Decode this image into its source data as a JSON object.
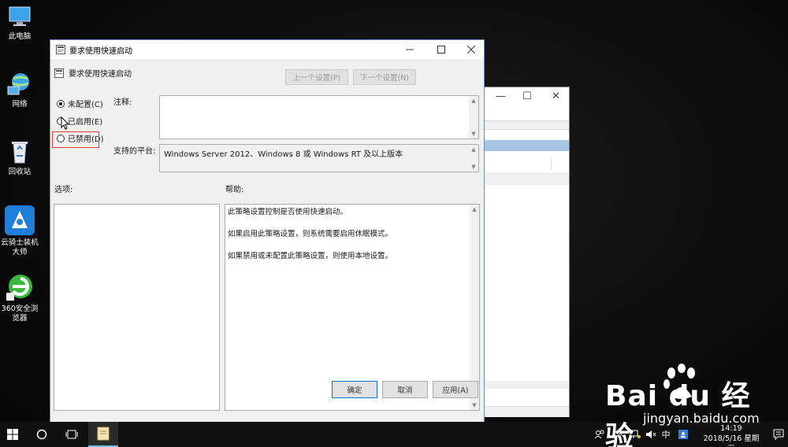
{
  "desktop": {
    "icons": [
      {
        "label": "此电脑",
        "icon": "this-pc-icon"
      },
      {
        "label": "网络",
        "icon": "network-icon"
      },
      {
        "label": "回收站",
        "icon": "recycle-bin-icon"
      },
      {
        "label": "云骑士装机大师",
        "icon": "yunqishi-icon"
      },
      {
        "label": "360安全浏览器",
        "icon": "browser-360-icon"
      }
    ]
  },
  "background_window": {
    "minimize": "—",
    "maximize": "☐",
    "close": "✕"
  },
  "dialog": {
    "title": "要求使用快速启动",
    "setting_name": "要求使用快速启动",
    "prev_button": "上一个设置(P)",
    "next_button": "下一个设置(N)",
    "radios": [
      {
        "label": "未配置(C)",
        "checked": true
      },
      {
        "label": "已启用(E)",
        "checked": false
      },
      {
        "label": "已禁用(D)",
        "checked": false
      }
    ],
    "comment_label": "注释:",
    "comment_value": "",
    "platform_label": "支持的平台:",
    "platform_value": "Windows Server 2012、Windows 8 或 Windows RT 及以上版本",
    "options_label": "选项:",
    "help_label": "帮助:",
    "help_paragraphs": [
      "此策略设置控制是否使用快速启动。",
      "如果启用此策略设置，则系统需要启用休眠模式。",
      "如果禁用或未配置此策略设置，则使用本地设置。"
    ],
    "ok_button": "确定",
    "cancel_button": "取消",
    "apply_button": "应用(A)"
  },
  "taskbar": {
    "ime": "中",
    "time": "14:19",
    "date": "2018/5/16 星期三"
  },
  "watermark": {
    "brand": "Bai du 经验",
    "url": "jingyan.baidu.com"
  },
  "colors": {
    "dialog_bg": "#f0f0f0",
    "highlight": "#e23b3b",
    "taskbar": "#101010"
  }
}
